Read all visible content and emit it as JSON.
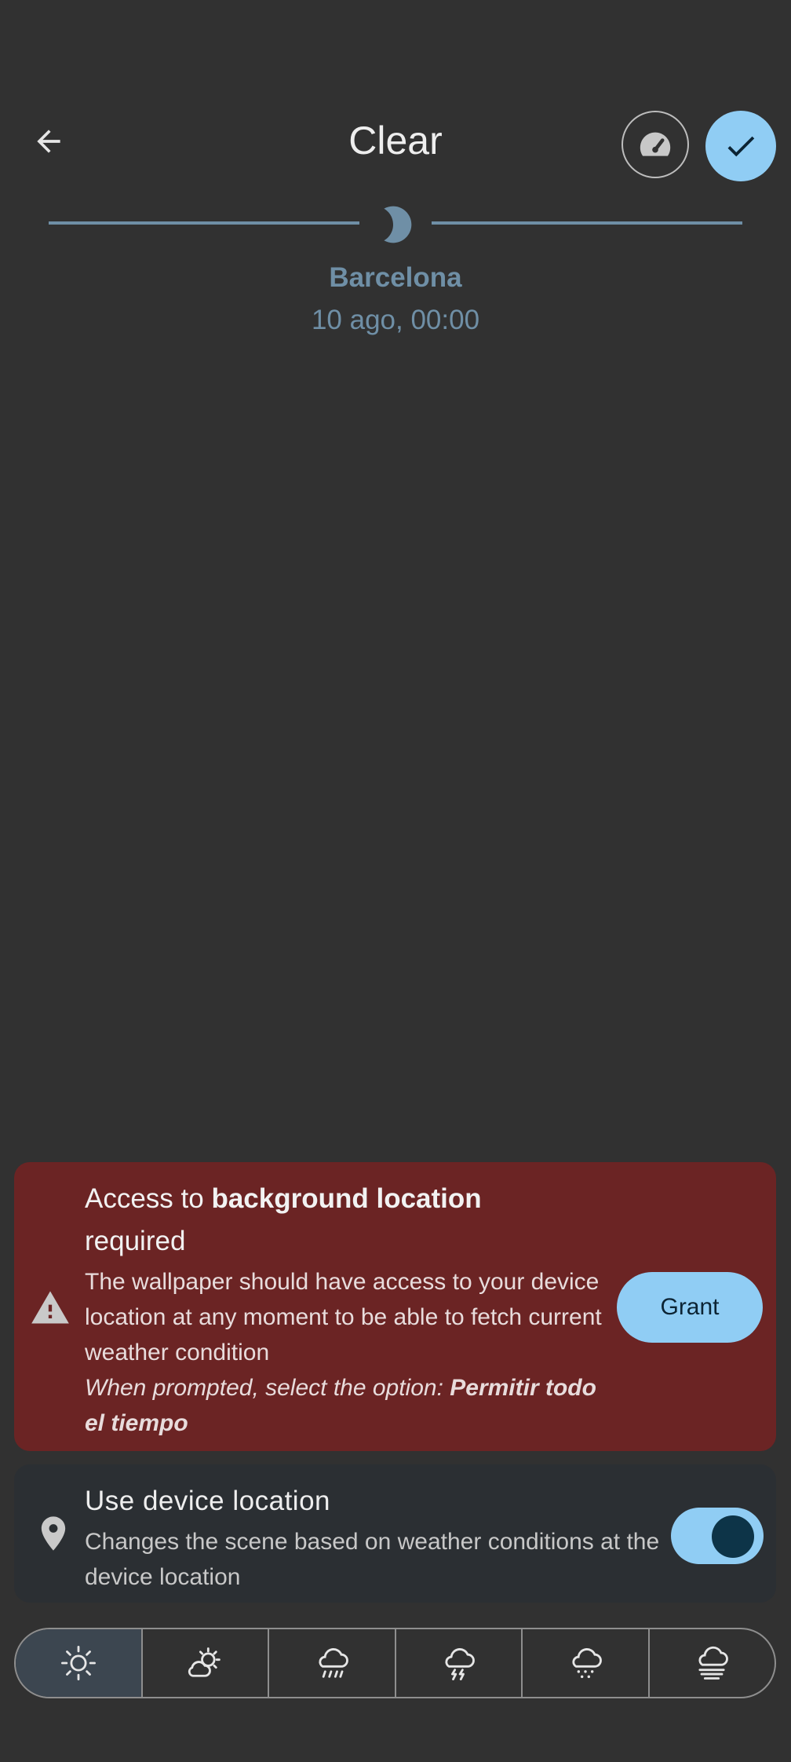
{
  "header": {
    "title": "Clear",
    "back_icon": "arrow-back-icon",
    "gauge_icon": "speedometer-icon",
    "confirm_icon": "check-icon",
    "accent_color": "#90cdf4"
  },
  "timeline": {
    "icon": "moon-icon",
    "location": "Barcelona",
    "datetime": "10 ago, 00:00"
  },
  "warning": {
    "title_prefix": "Access to ",
    "title_bold": "background location",
    "title_suffix": "required",
    "body": "The wallpaper should have access to your device location at any moment to be able to fetch current weather condition",
    "note_prefix": "When prompted, select the option: ",
    "note_bold": "Permitir todo el tiempo",
    "grant_label": "Grant",
    "icon": "warning-icon",
    "background_color": "#6b2424"
  },
  "device_location": {
    "title": "Use device location",
    "description": "Changes the scene based on weather conditions at the device location",
    "icon": "location-pin-icon",
    "enabled": true
  },
  "weather_options": [
    {
      "icon": "sun-icon",
      "selected": true
    },
    {
      "icon": "partly-cloudy-icon",
      "selected": false
    },
    {
      "icon": "rain-icon",
      "selected": false
    },
    {
      "icon": "thunderstorm-icon",
      "selected": false
    },
    {
      "icon": "snow-icon",
      "selected": false
    },
    {
      "icon": "fog-icon",
      "selected": false
    }
  ]
}
